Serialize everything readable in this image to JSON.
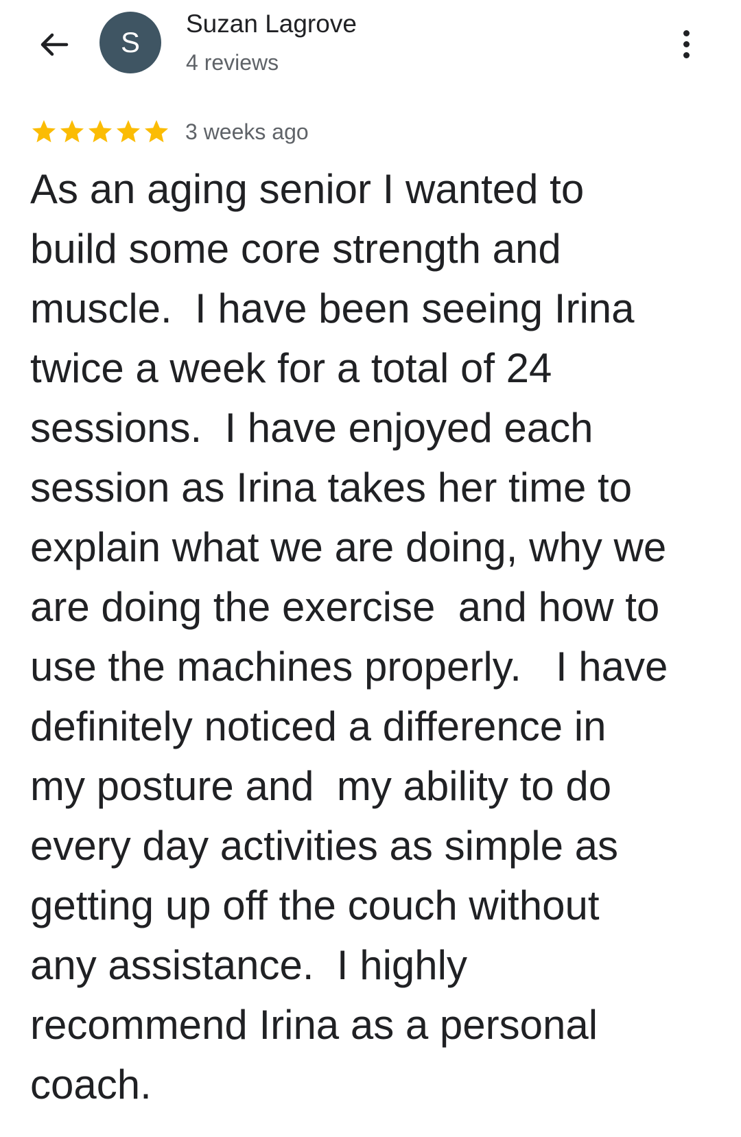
{
  "header": {
    "back_icon": "arrow-back-icon",
    "avatar_letter": "S",
    "avatar_color": "#3f5563",
    "reviewer_name": "Suzan Lagrove",
    "review_count": "4 reviews",
    "more_icon": "more-vert-icon"
  },
  "review": {
    "rating": 5,
    "rating_max": 5,
    "star_color": "#fbbc04",
    "date": "3 weeks ago",
    "text_lines": [
      "As an aging senior I wanted to",
      "build some core strength and",
      "muscle.  I have been seeing Irina",
      "twice a week for a total of 24",
      "sessions.  I have enjoyed each",
      "session as Irina takes her time to",
      "explain what we are doing, why we",
      "are doing the exercise  and how to",
      "use the machines properly.   I have",
      "definitely noticed a difference in",
      "my posture and  my ability to do",
      "every day activities as simple as",
      "getting up off the couch without",
      "any assistance.  I highly",
      "recommend Irina as a personal",
      "coach."
    ]
  }
}
